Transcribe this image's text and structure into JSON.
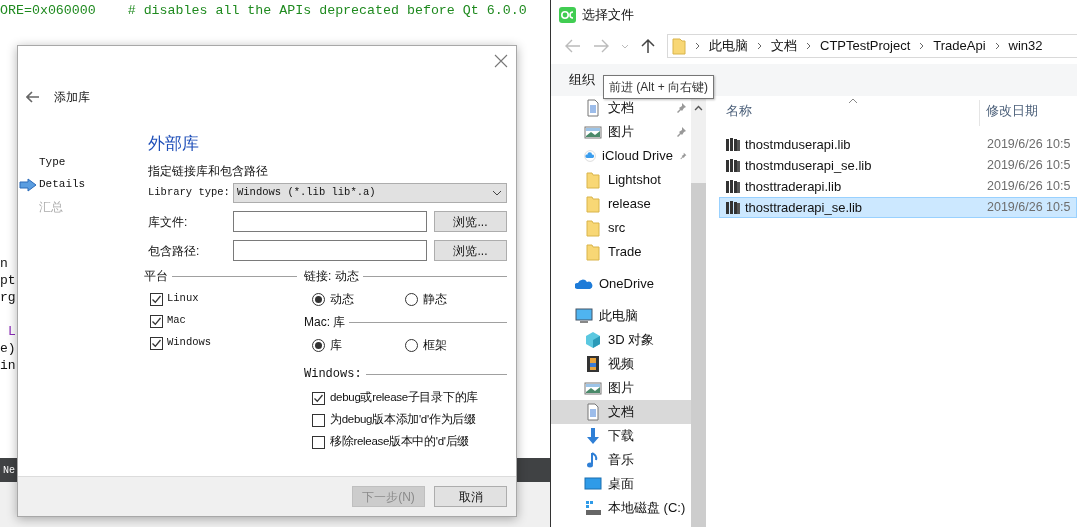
{
  "editor": {
    "code_line": "ORE=0x060000    # disables all the APIs deprecated before Qt 6.0.0",
    "fragments": [
      {
        "text": "n",
        "kind": "plain"
      },
      {
        "text": "pt",
        "kind": "plain"
      },
      {
        "text": "rg",
        "kind": "plain"
      },
      {
        "text": "L",
        "kind": "keyword"
      },
      {
        "text": "e)",
        "kind": "plain"
      },
      {
        "text": "in",
        "kind": "plain"
      }
    ],
    "bar_text": "Ne"
  },
  "add_library_dialog": {
    "title": "添加库",
    "steps": [
      {
        "label": "Type",
        "selected": false,
        "disabled": false
      },
      {
        "label": "Details",
        "selected": true,
        "disabled": false
      },
      {
        "label": "汇总",
        "selected": false,
        "disabled": true
      }
    ],
    "heading": "外部库",
    "subtitle": "指定链接库和包含路径",
    "library_type": {
      "label": "Library type:",
      "value": "Windows (*.lib lib*.a)"
    },
    "paths": [
      {
        "label": "库文件:",
        "button": "浏览..."
      },
      {
        "label": "包含路径:",
        "button": "浏览..."
      }
    ],
    "platform": {
      "title": "平台",
      "options": [
        {
          "label": "Linux",
          "checked": true
        },
        {
          "label": "Mac",
          "checked": true
        },
        {
          "label": "Windows",
          "checked": true
        }
      ]
    },
    "linkage": {
      "title": "链接: 动态",
      "options": [
        {
          "label": "动态",
          "selected": true
        },
        {
          "label": "静态",
          "selected": false
        }
      ]
    },
    "mac": {
      "title": "Mac: 库",
      "options": [
        {
          "label": "库",
          "selected": true
        },
        {
          "label": "框架",
          "selected": false
        }
      ]
    },
    "windows": {
      "title": "Windows:",
      "options": [
        {
          "label": "debug或release子目录下的库",
          "checked": true
        },
        {
          "label": "为debug版本添加'd'作为后缀",
          "checked": false
        },
        {
          "label": "移除release版本中的'd'后缀",
          "checked": false
        }
      ]
    },
    "buttons": [
      {
        "label": "下一步(N)",
        "disabled": true
      },
      {
        "label": "取消",
        "disabled": false
      }
    ]
  },
  "file_dialog": {
    "title": "选择文件",
    "breadcrumbs": [
      "此电脑",
      "文档",
      "CTPTestProject",
      "TradeApi",
      "win32"
    ],
    "toolbar": {
      "organize": "组织"
    },
    "tooltip": "前进 (Alt + 向右键)",
    "sidebar": {
      "quick_access": [
        {
          "label": "文档",
          "kind": "document",
          "pinned": true,
          "selected": false
        },
        {
          "label": "图片",
          "kind": "pictures",
          "pinned": true,
          "selected": false
        },
        {
          "label": "iCloud Drive",
          "kind": "cloud",
          "pinned": true,
          "selected": false
        },
        {
          "label": "Lightshot",
          "kind": "folder",
          "pinned": false,
          "selected": false
        },
        {
          "label": "release",
          "kind": "folder",
          "pinned": false,
          "selected": false
        },
        {
          "label": "src",
          "kind": "folder",
          "pinned": false,
          "selected": false
        },
        {
          "label": "Trade",
          "kind": "folder",
          "pinned": false,
          "selected": false
        }
      ],
      "onedrive": {
        "label": "OneDrive",
        "kind": "onedrive",
        "selected": false
      },
      "this_pc": {
        "label": "此电脑",
        "kind": "computer",
        "selected": false,
        "children": [
          {
            "label": "3D 对象",
            "kind": "cube",
            "selected": false
          },
          {
            "label": "视频",
            "kind": "video",
            "selected": false
          },
          {
            "label": "图片",
            "kind": "pictures",
            "selected": false
          },
          {
            "label": "文档",
            "kind": "document",
            "selected": true
          },
          {
            "label": "下载",
            "kind": "download",
            "selected": false
          },
          {
            "label": "音乐",
            "kind": "music",
            "selected": false
          },
          {
            "label": "桌面",
            "kind": "desktop",
            "selected": false
          },
          {
            "label": "本地磁盘 (C:)",
            "kind": "drive",
            "selected": false
          }
        ]
      }
    },
    "columns": [
      "名称",
      "修改日期"
    ],
    "files": [
      {
        "name": "thostmduserapi.lib",
        "date": "2019/6/26 10:5",
        "selected": false
      },
      {
        "name": "thostmduserapi_se.lib",
        "date": "2019/6/26 10:5",
        "selected": false
      },
      {
        "name": "thosttraderapi.lib",
        "date": "2019/6/26 10:5",
        "selected": false
      },
      {
        "name": "thosttraderapi_se.lib",
        "date": "2019/6/26 10:5",
        "selected": true
      }
    ]
  }
}
